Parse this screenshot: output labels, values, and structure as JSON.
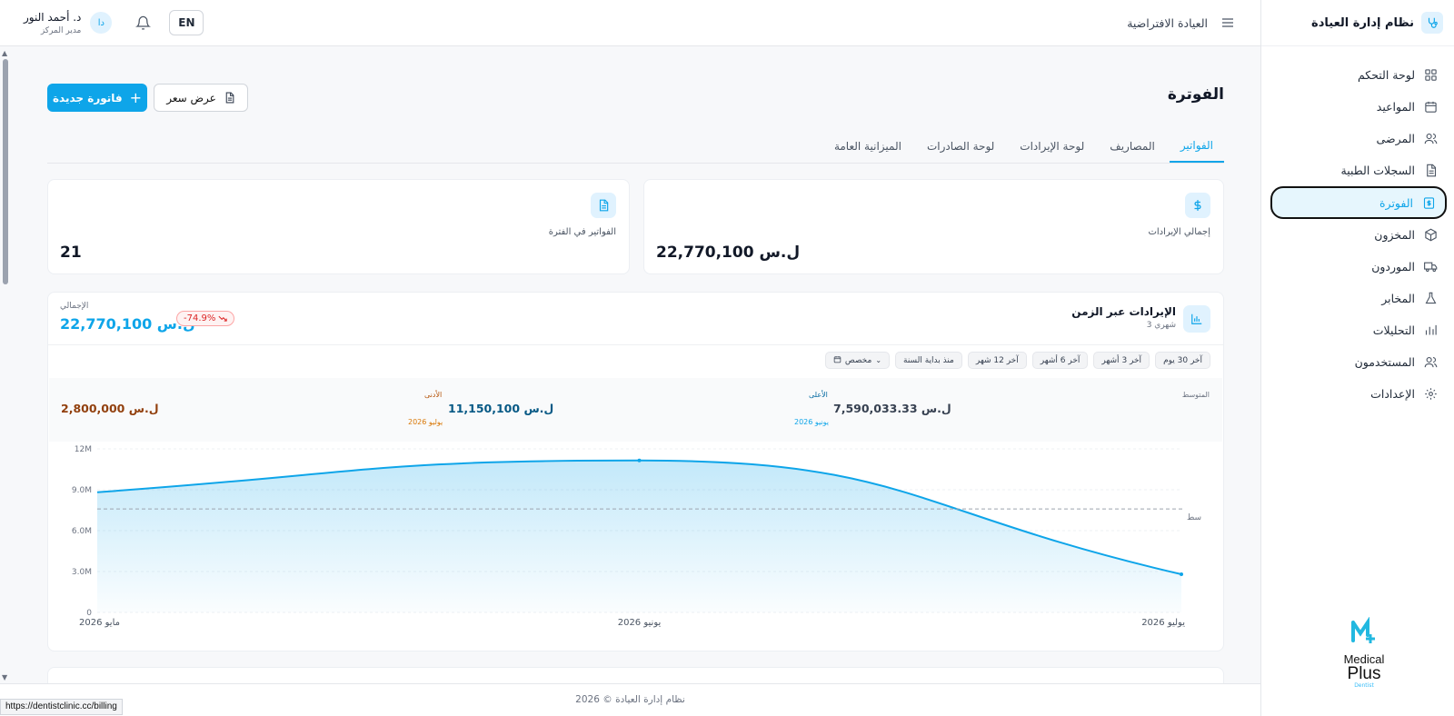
{
  "sidebar": {
    "title": "نظام إدارة العيادة",
    "items": [
      {
        "label": "لوحة التحكم",
        "icon": "dashboard-icon"
      },
      {
        "label": "المواعيد",
        "icon": "calendar-icon"
      },
      {
        "label": "المرضى",
        "icon": "users-icon"
      },
      {
        "label": "السجلات الطبية",
        "icon": "document-icon"
      },
      {
        "label": "الفوترة",
        "icon": "invoice-icon",
        "active": true
      },
      {
        "label": "المخزون",
        "icon": "box-icon"
      },
      {
        "label": "الموردون",
        "icon": "truck-icon"
      },
      {
        "label": "المخابر",
        "icon": "flask-icon"
      },
      {
        "label": "التحليلات",
        "icon": "bar-chart-icon"
      },
      {
        "label": "المستخدمون",
        "icon": "users-icon"
      },
      {
        "label": "الإعدادات",
        "icon": "gear-icon"
      }
    ],
    "brand": {
      "line1": "Medical",
      "line2": "Plus",
      "line3": "Dentist"
    }
  },
  "topbar": {
    "clinic": "العيادة الافتراضية",
    "lang": "EN",
    "user_name": "د. أحمد النور",
    "user_role": "مدير المركز",
    "avatar": "دا"
  },
  "page": {
    "title": "الفوترة",
    "new_invoice": "فاتورة جديدة",
    "quote": "عرض سعر"
  },
  "tabs": [
    "الفواتير",
    "المصاريف",
    "لوحة الإيرادات",
    "لوحة الصادرات",
    "الميزانية العامة"
  ],
  "stats": {
    "revenue_label": "إجمالي الإيرادات",
    "revenue_value": "22,770,100 ل.س",
    "invoices_label": "الفواتير في الفترة",
    "invoices_value": "21"
  },
  "chart_card": {
    "title": "الإيرادات عبر الزمن",
    "subtitle": "3 شهري",
    "total_label": "الإجمالي",
    "total_value": "22,770,100 ل.س",
    "change": "-74.9%",
    "filters": [
      "آخر 30 يوم",
      "آخر 3 أشهر",
      "آخر 6 أشهر",
      "آخر 12 شهر",
      "منذ بداية السنة",
      "مخصص"
    ],
    "avg_label": "المتوسط",
    "avg_value": "7,590,033.33 ل.س",
    "max_label": "الأعلى",
    "max_value": "11,150,100 ل.س",
    "max_date": "يونيو 2026",
    "min_label": "الأدنى",
    "min_value": "2,800,000 ل.س",
    "min_date": "يوليو 2026",
    "avg_line_label": "سط"
  },
  "chart_data": {
    "type": "area",
    "categories": [
      "مايو 2026",
      "يونيو 2026",
      "يوليو 2026"
    ],
    "values": [
      8820000,
      11150100,
      2800000
    ],
    "average": 7590033.33,
    "ylim": [
      0,
      12000000
    ],
    "yticks": [
      "0",
      "3.0M",
      "6.0M",
      "9.0M",
      "12M"
    ],
    "color": "#0ea5e9",
    "grid": true
  },
  "footer": "نظام إدارة العيادة © 2026",
  "status_url": "https://dentistclinic.cc/billing"
}
